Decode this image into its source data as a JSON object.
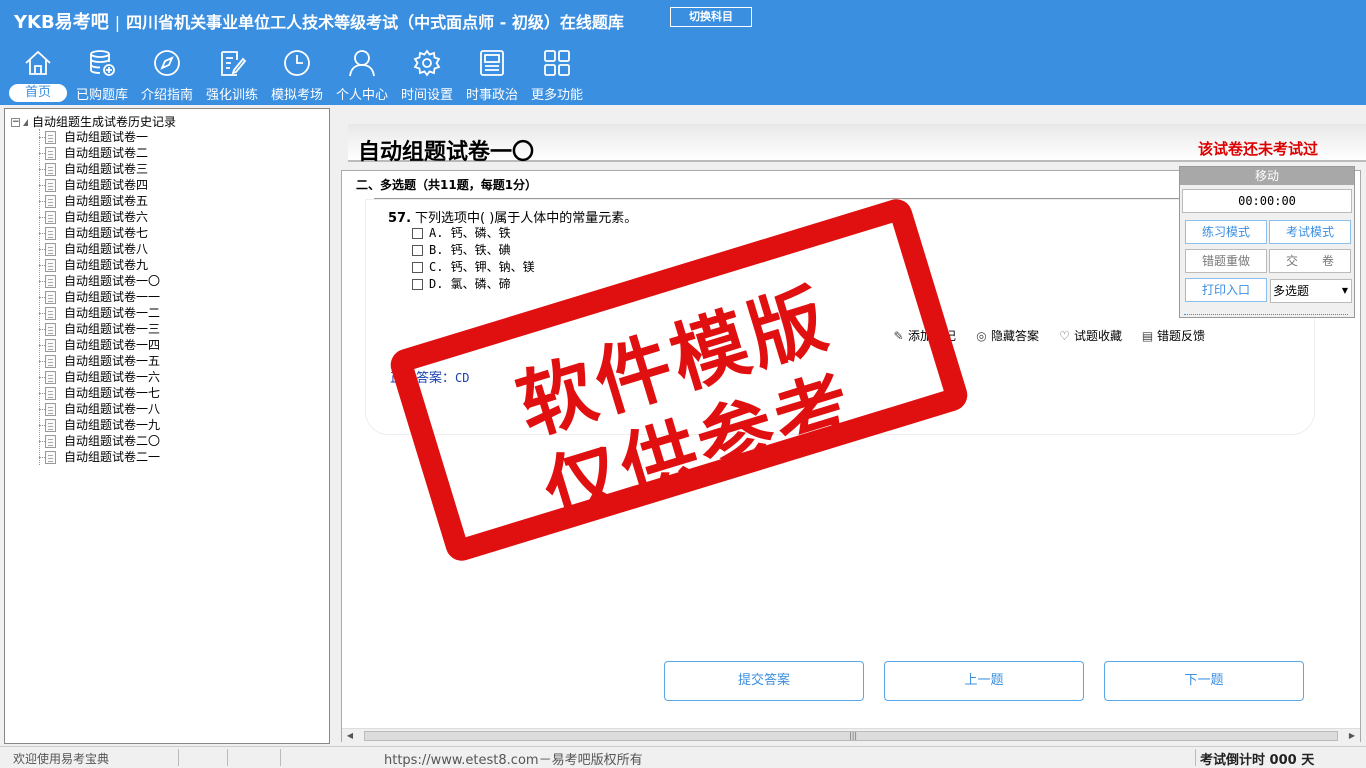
{
  "header": {
    "brand": "YKB易考吧",
    "separator": "|",
    "title": "四川省机关事业单位工人技术等级考试（中式面点师 - 初级）在线题库",
    "switch_label": "切换科目"
  },
  "nav": [
    {
      "label": "首页",
      "icon": "home-icon"
    },
    {
      "label": "已购题库",
      "icon": "database-icon"
    },
    {
      "label": "介绍指南",
      "icon": "compass-icon"
    },
    {
      "label": "强化训练",
      "icon": "edit-icon"
    },
    {
      "label": "模拟考场",
      "icon": "clock-icon"
    },
    {
      "label": "个人中心",
      "icon": "user-icon"
    },
    {
      "label": "时间设置",
      "icon": "gear-icon"
    },
    {
      "label": "时事政治",
      "icon": "news-icon"
    },
    {
      "label": "更多功能",
      "icon": "grid-icon"
    }
  ],
  "tree": {
    "root": "自动组题生成试卷历史记录",
    "items": [
      "自动组题试卷一",
      "自动组题试卷二",
      "自动组题试卷三",
      "自动组题试卷四",
      "自动组题试卷五",
      "自动组题试卷六",
      "自动组题试卷七",
      "自动组题试卷八",
      "自动组题试卷九",
      "自动组题试卷一〇",
      "自动组题试卷一一",
      "自动组题试卷一二",
      "自动组题试卷一三",
      "自动组题试卷一四",
      "自动组题试卷一五",
      "自动组题试卷一六",
      "自动组题试卷一七",
      "自动组题试卷一八",
      "自动组题试卷一九",
      "自动组题试卷二〇",
      "自动组题试卷二一"
    ]
  },
  "paper": {
    "title": "自动组题试卷一〇",
    "status": "该试卷还未考试过"
  },
  "section": {
    "heading": "二、多选题（共11题，每题1分）"
  },
  "question": {
    "number": "57.",
    "text": "下列选项中(  )属于人体中的常量元素。",
    "options": [
      "A. 钙、磷、铁",
      "B. 钙、铁、碘",
      "C. 钙、钾、钠、镁",
      "D. 氯、磷、碲"
    ]
  },
  "tools": {
    "add_note": "添加笔记",
    "hide_answer": "隐藏答案",
    "favorite": "试题收藏",
    "feedback": "错题反馈"
  },
  "answer": {
    "label": "正确答案：",
    "value": "CD"
  },
  "buttons": {
    "submit": "提交答案",
    "prev": "上一题",
    "next": "下一题"
  },
  "side_panel": {
    "move": "移动",
    "timer": "00:00:00",
    "practice_mode": "练习模式",
    "exam_mode": "考试模式",
    "redo_wrong": "错题重做",
    "hand_in": "交　　卷",
    "print": "打印入口",
    "type_selected": "多选题"
  },
  "watermark": {
    "line1": "软件模版",
    "line2": "仅供参考"
  },
  "status_bar": {
    "welcome": "欢迎使用易考宝典",
    "copyright": "https://www.etest8.com－易考吧版权所有",
    "countdown": "考试倒计时 000 天"
  },
  "colors": {
    "header_blue": "#3b8fe0",
    "status_red": "#dd0000",
    "answer_blue": "#1a3fb0",
    "stamp_red": "#e01010"
  }
}
